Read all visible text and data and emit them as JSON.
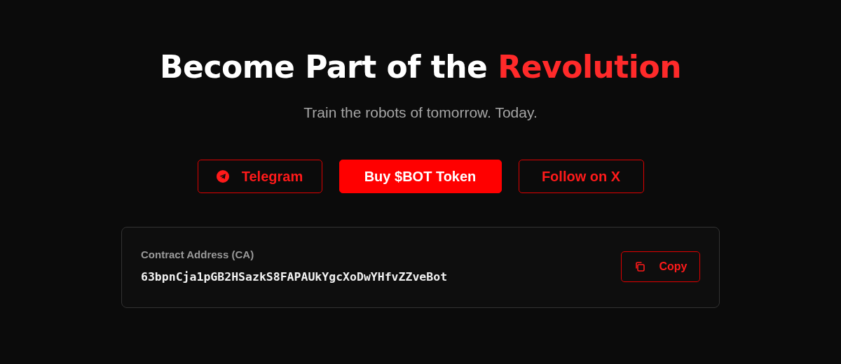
{
  "heading": {
    "text": "Become Part of the",
    "highlight": "Revolution"
  },
  "subtitle": "Train the robots of tomorrow. Today.",
  "buttons": [
    {
      "label": "Telegram",
      "kind": "social"
    },
    {
      "label": "Buy $BOT Token",
      "kind": "solid"
    },
    {
      "label": "Follow on X",
      "kind": "outline"
    }
  ],
  "contract": {
    "label": "Contract Address (CA)",
    "address": "63bpnCja1pGB2HSazkS8FAPAUkYgcXoDwYHfvZZveBot",
    "button": "Copy"
  }
}
